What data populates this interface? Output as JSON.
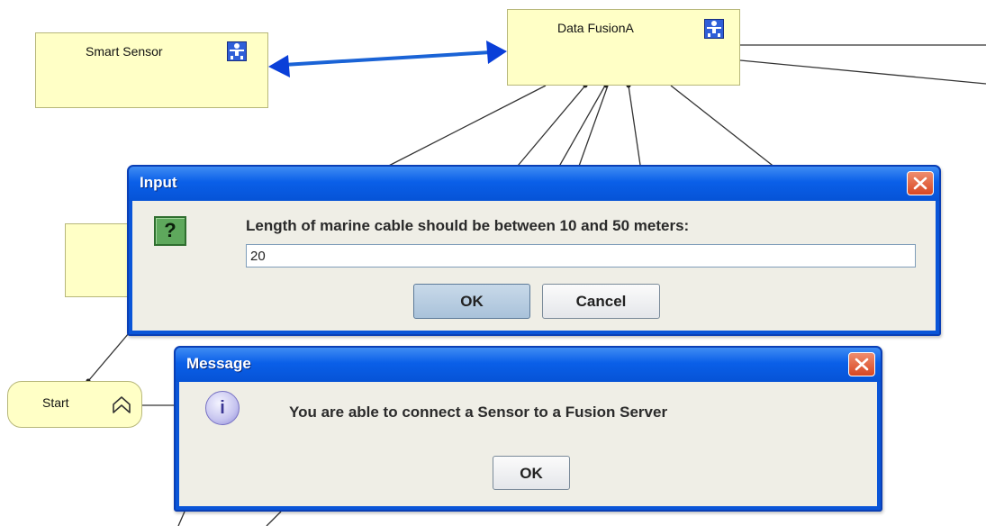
{
  "diagram": {
    "nodes": {
      "smart_sensor": "Smart Sensor",
      "data_fusion": "Data FusionA",
      "start": "Start"
    }
  },
  "input_dialog": {
    "title": "Input",
    "prompt": "Length of marine cable should be between 10 and 50 meters:",
    "value": "20",
    "ok_label": "OK",
    "cancel_label": "Cancel",
    "icon": "question-icon"
  },
  "message_dialog": {
    "title": "Message",
    "message": "You are able to connect a Sensor to a Fusion Server",
    "ok_label": "OK",
    "icon": "info-icon"
  },
  "colors": {
    "node_fill": "#ffffc6",
    "title_bar": "#0a5fe8",
    "connector": "#1a63d6",
    "close_button": "#d84722"
  }
}
